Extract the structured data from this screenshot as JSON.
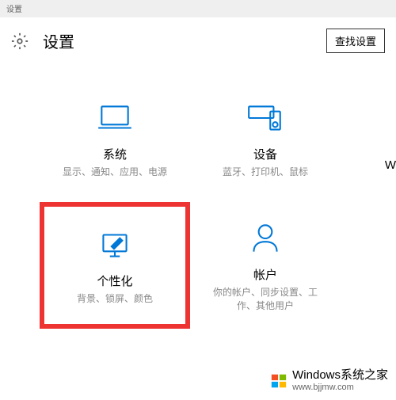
{
  "window": {
    "titlebar": "设置"
  },
  "header": {
    "title": "设置",
    "search_button": "查找设置"
  },
  "tiles": {
    "system": {
      "title": "系统",
      "desc": "显示、通知、应用、电源"
    },
    "devices": {
      "title": "设备",
      "desc": "蓝牙、打印机、鼠标"
    },
    "personalization": {
      "title": "个性化",
      "desc": "背景、锁屏、颜色"
    },
    "accounts": {
      "title": "帐户",
      "desc": "你的帐户、同步设置、工作、其他用户"
    },
    "partial_right": "W"
  },
  "watermark": {
    "brand": "Windows系统之家",
    "url": "www.bjjmw.com"
  }
}
